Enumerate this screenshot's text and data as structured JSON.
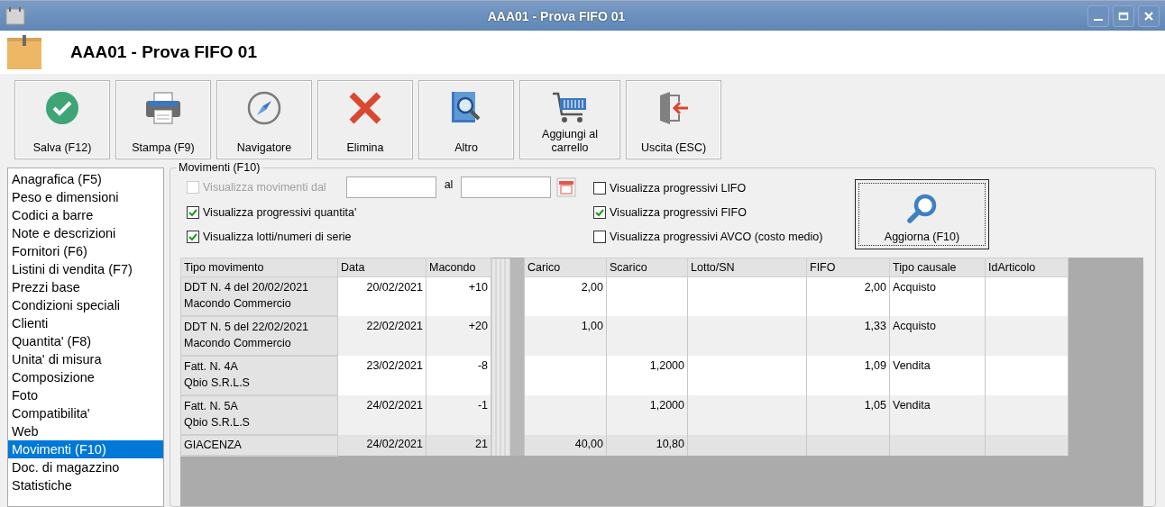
{
  "window": {
    "title": "AAA01 - Prova FIFO 01"
  },
  "header": {
    "title": "AAA01 - Prova FIFO 01"
  },
  "toolbar": [
    {
      "kind": "save",
      "label": "Salva (F12)"
    },
    {
      "kind": "print",
      "label": "Stampa (F9)"
    },
    {
      "kind": "navigator",
      "label": "Navigatore"
    },
    {
      "kind": "delete",
      "label": "Elimina"
    },
    {
      "kind": "more",
      "label": "Altro"
    },
    {
      "kind": "cart",
      "label": "Aggiungi al carrello"
    },
    {
      "kind": "exit",
      "label": "Uscita (ESC)"
    }
  ],
  "sidebar": {
    "items": [
      {
        "label": "Anagrafica (F5)",
        "selected": false
      },
      {
        "label": "Peso e dimensioni",
        "selected": false
      },
      {
        "label": "Codici a barre",
        "selected": false
      },
      {
        "label": "Note e descrizioni",
        "selected": false
      },
      {
        "label": "Fornitori (F6)",
        "selected": false
      },
      {
        "label": "Listini di vendita (F7)",
        "selected": false
      },
      {
        "label": "Prezzi base",
        "selected": false
      },
      {
        "label": "Condizioni speciali",
        "selected": false
      },
      {
        "label": "Clienti",
        "selected": false
      },
      {
        "label": "Quantita' (F8)",
        "selected": false
      },
      {
        "label": "Unita' di misura",
        "selected": false
      },
      {
        "label": "Composizione",
        "selected": false
      },
      {
        "label": "Foto",
        "selected": false
      },
      {
        "label": "Compatibilita'",
        "selected": false
      },
      {
        "label": "Web",
        "selected": false
      },
      {
        "label": "Movimenti (F10)",
        "selected": true
      },
      {
        "label": "Doc. di magazzino",
        "selected": false
      },
      {
        "label": "Statistiche",
        "selected": false
      }
    ]
  },
  "panel": {
    "legend": "Movimenti (F10)",
    "date_filter": {
      "label": "Visualizza movimenti dal",
      "checked": false,
      "disabled": true,
      "separator": "al"
    },
    "options_left": [
      {
        "label": "Visualizza progressivi quantita'",
        "checked": true
      },
      {
        "label": "Visualizza lotti/numeri di serie",
        "checked": true
      }
    ],
    "options_right": [
      {
        "label": "Visualizza progressivi LIFO",
        "checked": false
      },
      {
        "label": "Visualizza progressivi FIFO",
        "checked": true
      },
      {
        "label": "Visualizza progressivi AVCO (costo medio)",
        "checked": false
      }
    ],
    "refresh_button": {
      "label": "Aggiorna (F10)"
    },
    "table": {
      "columns": [
        {
          "label": "Tipo movimento",
          "kind": "text"
        },
        {
          "label": "Data",
          "kind": "number"
        },
        {
          "label": "Macondo",
          "kind": "number"
        },
        {
          "label": "Carico",
          "kind": "number"
        },
        {
          "label": "Scarico",
          "kind": "number"
        },
        {
          "label": "Lotto/SN",
          "kind": "text"
        },
        {
          "label": "FIFO",
          "kind": "number"
        },
        {
          "label": "Tipo causale",
          "kind": "text"
        },
        {
          "label": "IdArticolo",
          "kind": "text"
        }
      ],
      "rows": [
        {
          "kind": "movement",
          "cells": [
            [
              "DDT N. 4 del 20/02/2021",
              "Macondo Commercio"
            ],
            "20/02/2021",
            "+10",
            "2,00",
            null,
            null,
            "2,00",
            "Acquisto",
            null
          ]
        },
        {
          "kind": "movement",
          "cells": [
            [
              "DDT N. 5 del 22/02/2021",
              "Macondo Commercio"
            ],
            "22/02/2021",
            "+20",
            "1,00",
            null,
            null,
            "1,33",
            "Acquisto",
            null
          ]
        },
        {
          "kind": "movement",
          "cells": [
            [
              "Fatt. N. 4A",
              "Qbio S.R.L.S"
            ],
            "23/02/2021",
            "-8",
            null,
            "1,2000",
            null,
            "1,09",
            "Vendita",
            null
          ]
        },
        {
          "kind": "movement",
          "cells": [
            [
              "Fatt. N. 5A",
              "Qbio S.R.L.S"
            ],
            "24/02/2021",
            "-1",
            null,
            "1,2000",
            null,
            "1,05",
            "Vendita",
            null
          ]
        },
        {
          "kind": "total",
          "cells": [
            "GIACENZA",
            "24/02/2021",
            "21",
            "40,00",
            "10,80",
            null,
            null,
            null,
            null
          ]
        }
      ]
    }
  }
}
